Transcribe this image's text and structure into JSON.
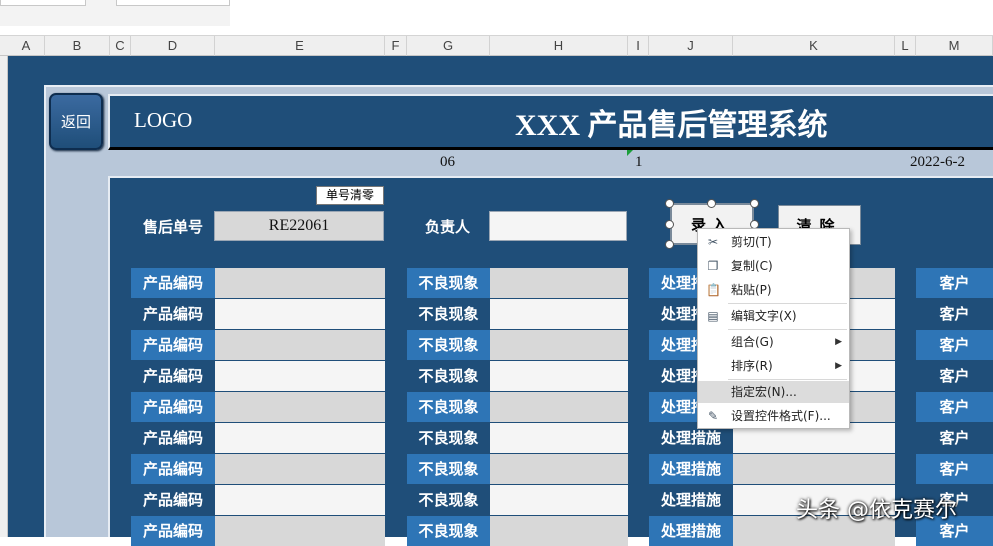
{
  "columns": [
    "A",
    "B",
    "C",
    "D",
    "E",
    "F",
    "G",
    "H",
    "I",
    "J",
    "K",
    "L",
    "M"
  ],
  "back_button": "返回",
  "logo": "LOGO",
  "title": "XXX 产品售后管理系统",
  "info": {
    "a": "06",
    "b": "1",
    "date": "2022-6-2"
  },
  "form": {
    "clear_order_button": "单号清零",
    "order_label": "售后单号",
    "order_value": "RE22061",
    "manager_label": "负责人",
    "manager_value": "",
    "entry_button": "录入",
    "clear_button": "清除"
  },
  "rows": [
    {
      "code": "产品编码",
      "defect": "不良现象",
      "measure": "处理措施",
      "customer": "客户"
    },
    {
      "code": "产品编码",
      "defect": "不良现象",
      "measure": "处理措施",
      "customer": "客户"
    },
    {
      "code": "产品编码",
      "defect": "不良现象",
      "measure": "处理措施",
      "customer": "客户"
    },
    {
      "code": "产品编码",
      "defect": "不良现象",
      "measure": "处理措施",
      "customer": "客户"
    },
    {
      "code": "产品编码",
      "defect": "不良现象",
      "measure": "处理措施",
      "customer": "客户"
    },
    {
      "code": "产品编码",
      "defect": "不良现象",
      "measure": "处理措施",
      "customer": "客户"
    },
    {
      "code": "产品编码",
      "defect": "不良现象",
      "measure": "处理措施",
      "customer": "客户"
    },
    {
      "code": "产品编码",
      "defect": "不良现象",
      "measure": "处理措施",
      "customer": "客户"
    },
    {
      "code": "产品编码",
      "defect": "不良现象",
      "measure": "处理措施",
      "customer": "客户"
    }
  ],
  "context_menu": {
    "items": [
      {
        "label": "剪切(T)",
        "icon": "scissors-icon"
      },
      {
        "label": "复制(C)",
        "icon": "copy-icon"
      },
      {
        "label": "粘贴(P)",
        "icon": "paste-icon"
      },
      {
        "label": "编辑文字(X)",
        "icon": "edit-text-icon"
      },
      {
        "label": "组合(G)",
        "icon": "",
        "submenu": true
      },
      {
        "label": "排序(R)",
        "icon": "",
        "submenu": true
      },
      {
        "label": "指定宏(N)...",
        "icon": "",
        "highlighted": true
      },
      {
        "label": "设置控件格式(F)...",
        "icon": "format-control-icon"
      }
    ]
  },
  "watermark": "头条 @依克赛尔",
  "colors": {
    "dark_blue": "#1f4e79",
    "mid_blue": "#2e75b6",
    "light_bg": "#b8c7d9"
  }
}
